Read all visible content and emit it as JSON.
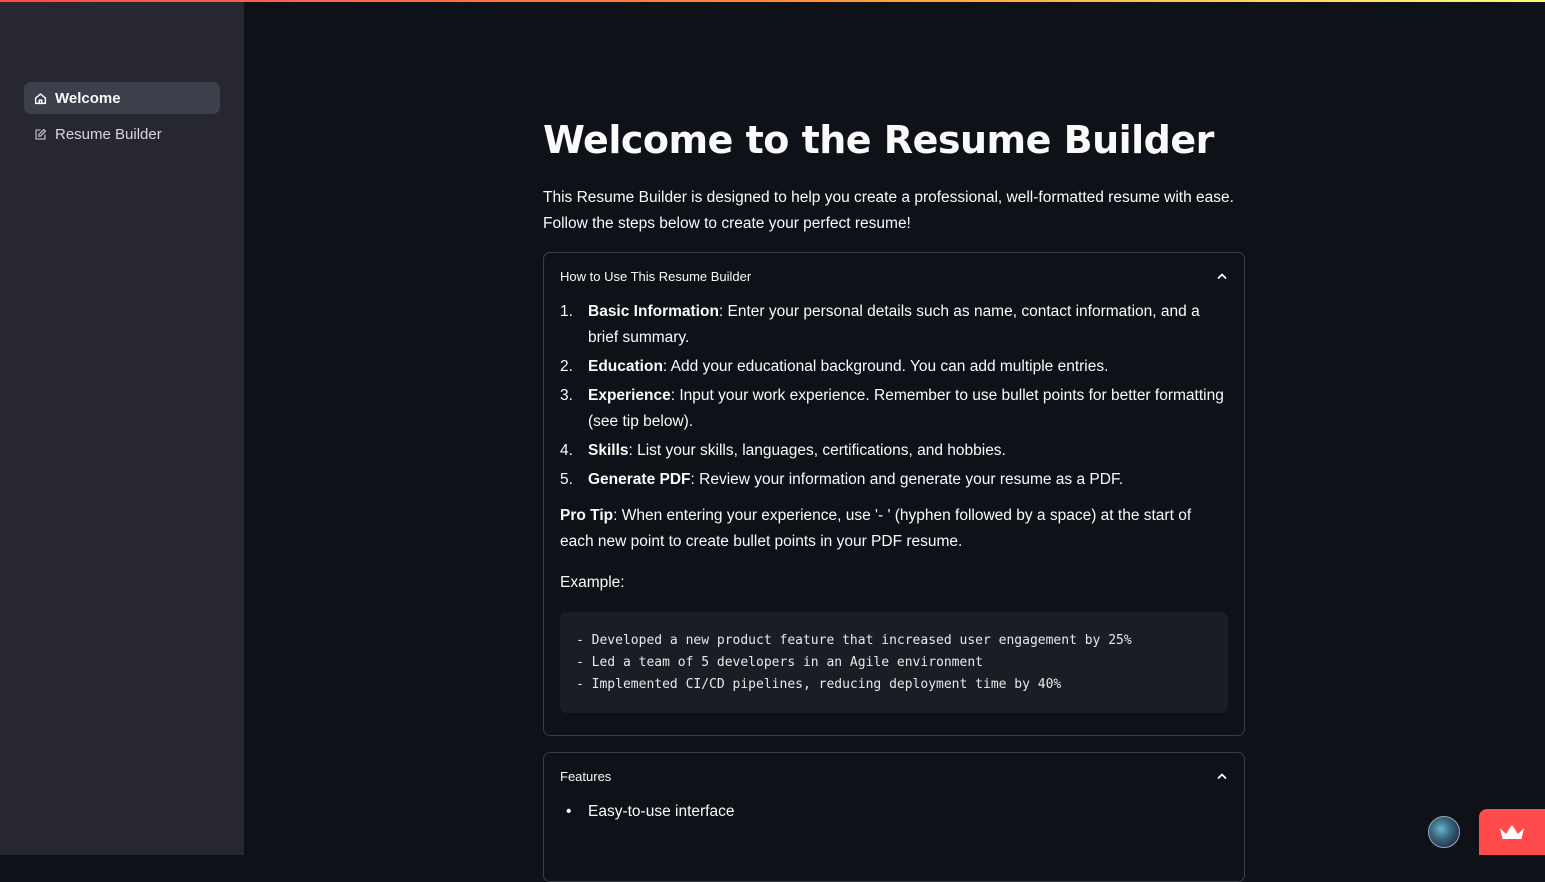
{
  "sidebar": {
    "items": [
      {
        "label": "Welcome",
        "icon": "home-icon",
        "active": true
      },
      {
        "label": "Resume Builder",
        "icon": "edit-icon",
        "active": false
      }
    ]
  },
  "main": {
    "title": "Welcome to the Resume Builder",
    "intro": "This Resume Builder is designed to help you create a professional, well-formatted resume with ease. Follow the steps below to create your perfect resume!",
    "how_to": {
      "header": "How to Use This Resume Builder",
      "expanded": true,
      "steps": [
        {
          "num": "1.",
          "bold": "Basic Information",
          "text": ": Enter your personal details such as name, contact information, and a brief summary."
        },
        {
          "num": "2.",
          "bold": "Education",
          "text": ": Add your educational background. You can add multiple entries."
        },
        {
          "num": "3.",
          "bold": "Experience",
          "text": ": Input your work experience. Remember to use bullet points for better formatting (see tip below)."
        },
        {
          "num": "4.",
          "bold": "Skills",
          "text": ": List your skills, languages, certifications, and hobbies."
        },
        {
          "num": "5.",
          "bold": "Generate PDF",
          "text": ": Review your information and generate your resume as a PDF."
        }
      ],
      "tip_bold": "Pro Tip",
      "tip_text": ": When entering your experience, use '- ' (hyphen followed by a space) at the start of each new point to create bullet points in your PDF resume.",
      "example_label": "Example:",
      "code_lines": [
        "- Developed a new product feature that increased user engagement by 25%",
        "- Led a team of 5 developers in an Agile environment",
        "- Implemented CI/CD pipelines, reducing deployment time by 40%"
      ]
    },
    "features": {
      "header": "Features",
      "expanded": true,
      "items": [
        "Easy-to-use interface"
      ]
    }
  },
  "colors": {
    "background": "#0e1117",
    "sidebar": "#262730",
    "accent": "#ff4b4b"
  }
}
